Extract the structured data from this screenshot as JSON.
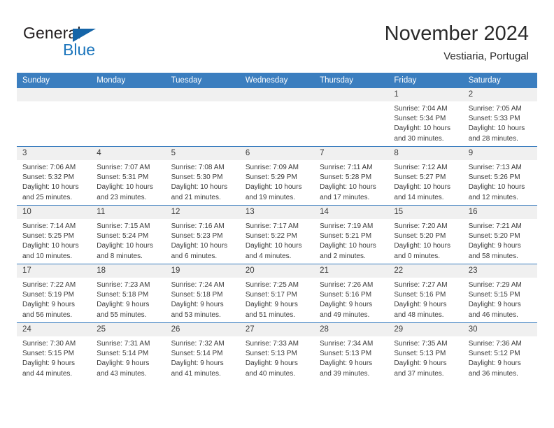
{
  "brand": {
    "name_part1": "General",
    "name_part2": "Blue",
    "flag_icon": "triangle-flag-icon",
    "accent_color": "#1b75bc"
  },
  "header": {
    "title": "November 2024",
    "subtitle": "Vestiaria, Portugal"
  },
  "theme": {
    "header_blue": "#3b7ebf",
    "daynum_bg": "#f0f0f0",
    "text": "#3b3b3b"
  },
  "calendar": {
    "weekday_headers": [
      "Sunday",
      "Monday",
      "Tuesday",
      "Wednesday",
      "Thursday",
      "Friday",
      "Saturday"
    ],
    "weeks": [
      [
        {
          "day": "",
          "lines": []
        },
        {
          "day": "",
          "lines": []
        },
        {
          "day": "",
          "lines": []
        },
        {
          "day": "",
          "lines": []
        },
        {
          "day": "",
          "lines": []
        },
        {
          "day": "1",
          "lines": [
            "Sunrise: 7:04 AM",
            "Sunset: 5:34 PM",
            "Daylight: 10 hours and 30 minutes."
          ]
        },
        {
          "day": "2",
          "lines": [
            "Sunrise: 7:05 AM",
            "Sunset: 5:33 PM",
            "Daylight: 10 hours and 28 minutes."
          ]
        }
      ],
      [
        {
          "day": "3",
          "lines": [
            "Sunrise: 7:06 AM",
            "Sunset: 5:32 PM",
            "Daylight: 10 hours and 25 minutes."
          ]
        },
        {
          "day": "4",
          "lines": [
            "Sunrise: 7:07 AM",
            "Sunset: 5:31 PM",
            "Daylight: 10 hours and 23 minutes."
          ]
        },
        {
          "day": "5",
          "lines": [
            "Sunrise: 7:08 AM",
            "Sunset: 5:30 PM",
            "Daylight: 10 hours and 21 minutes."
          ]
        },
        {
          "day": "6",
          "lines": [
            "Sunrise: 7:09 AM",
            "Sunset: 5:29 PM",
            "Daylight: 10 hours and 19 minutes."
          ]
        },
        {
          "day": "7",
          "lines": [
            "Sunrise: 7:11 AM",
            "Sunset: 5:28 PM",
            "Daylight: 10 hours and 17 minutes."
          ]
        },
        {
          "day": "8",
          "lines": [
            "Sunrise: 7:12 AM",
            "Sunset: 5:27 PM",
            "Daylight: 10 hours and 14 minutes."
          ]
        },
        {
          "day": "9",
          "lines": [
            "Sunrise: 7:13 AM",
            "Sunset: 5:26 PM",
            "Daylight: 10 hours and 12 minutes."
          ]
        }
      ],
      [
        {
          "day": "10",
          "lines": [
            "Sunrise: 7:14 AM",
            "Sunset: 5:25 PM",
            "Daylight: 10 hours and 10 minutes."
          ]
        },
        {
          "day": "11",
          "lines": [
            "Sunrise: 7:15 AM",
            "Sunset: 5:24 PM",
            "Daylight: 10 hours and 8 minutes."
          ]
        },
        {
          "day": "12",
          "lines": [
            "Sunrise: 7:16 AM",
            "Sunset: 5:23 PM",
            "Daylight: 10 hours and 6 minutes."
          ]
        },
        {
          "day": "13",
          "lines": [
            "Sunrise: 7:17 AM",
            "Sunset: 5:22 PM",
            "Daylight: 10 hours and 4 minutes."
          ]
        },
        {
          "day": "14",
          "lines": [
            "Sunrise: 7:19 AM",
            "Sunset: 5:21 PM",
            "Daylight: 10 hours and 2 minutes."
          ]
        },
        {
          "day": "15",
          "lines": [
            "Sunrise: 7:20 AM",
            "Sunset: 5:20 PM",
            "Daylight: 10 hours and 0 minutes."
          ]
        },
        {
          "day": "16",
          "lines": [
            "Sunrise: 7:21 AM",
            "Sunset: 5:20 PM",
            "Daylight: 9 hours and 58 minutes."
          ]
        }
      ],
      [
        {
          "day": "17",
          "lines": [
            "Sunrise: 7:22 AM",
            "Sunset: 5:19 PM",
            "Daylight: 9 hours and 56 minutes."
          ]
        },
        {
          "day": "18",
          "lines": [
            "Sunrise: 7:23 AM",
            "Sunset: 5:18 PM",
            "Daylight: 9 hours and 55 minutes."
          ]
        },
        {
          "day": "19",
          "lines": [
            "Sunrise: 7:24 AM",
            "Sunset: 5:18 PM",
            "Daylight: 9 hours and 53 minutes."
          ]
        },
        {
          "day": "20",
          "lines": [
            "Sunrise: 7:25 AM",
            "Sunset: 5:17 PM",
            "Daylight: 9 hours and 51 minutes."
          ]
        },
        {
          "day": "21",
          "lines": [
            "Sunrise: 7:26 AM",
            "Sunset: 5:16 PM",
            "Daylight: 9 hours and 49 minutes."
          ]
        },
        {
          "day": "22",
          "lines": [
            "Sunrise: 7:27 AM",
            "Sunset: 5:16 PM",
            "Daylight: 9 hours and 48 minutes."
          ]
        },
        {
          "day": "23",
          "lines": [
            "Sunrise: 7:29 AM",
            "Sunset: 5:15 PM",
            "Daylight: 9 hours and 46 minutes."
          ]
        }
      ],
      [
        {
          "day": "24",
          "lines": [
            "Sunrise: 7:30 AM",
            "Sunset: 5:15 PM",
            "Daylight: 9 hours and 44 minutes."
          ]
        },
        {
          "day": "25",
          "lines": [
            "Sunrise: 7:31 AM",
            "Sunset: 5:14 PM",
            "Daylight: 9 hours and 43 minutes."
          ]
        },
        {
          "day": "26",
          "lines": [
            "Sunrise: 7:32 AM",
            "Sunset: 5:14 PM",
            "Daylight: 9 hours and 41 minutes."
          ]
        },
        {
          "day": "27",
          "lines": [
            "Sunrise: 7:33 AM",
            "Sunset: 5:13 PM",
            "Daylight: 9 hours and 40 minutes."
          ]
        },
        {
          "day": "28",
          "lines": [
            "Sunrise: 7:34 AM",
            "Sunset: 5:13 PM",
            "Daylight: 9 hours and 39 minutes."
          ]
        },
        {
          "day": "29",
          "lines": [
            "Sunrise: 7:35 AM",
            "Sunset: 5:13 PM",
            "Daylight: 9 hours and 37 minutes."
          ]
        },
        {
          "day": "30",
          "lines": [
            "Sunrise: 7:36 AM",
            "Sunset: 5:12 PM",
            "Daylight: 9 hours and 36 minutes."
          ]
        }
      ]
    ]
  }
}
